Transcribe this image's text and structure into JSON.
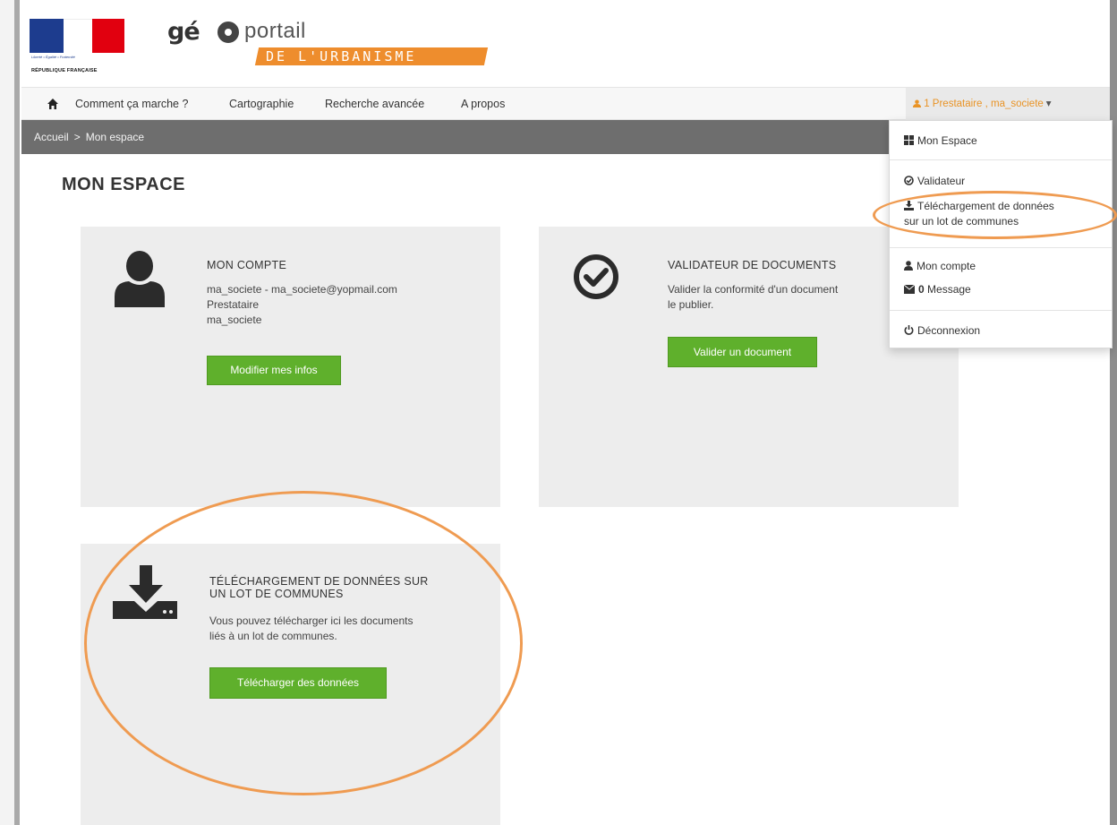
{
  "header": {
    "marianne_motto": "Liberté • Égalité • Fraternité",
    "marianne_country": "RÉPUBLIQUE FRANÇAISE",
    "logo_geo": "gé",
    "logo_portail": "portail",
    "logo_subtitle": "DE L'URBANISME"
  },
  "nav": {
    "items": [
      "Comment ça marche ?",
      "Cartographie",
      "Recherche avancée",
      "A propos"
    ],
    "user_label": "1 Prestataire , ma_societe"
  },
  "breadcrumb": {
    "home": "Accueil",
    "separator": ">",
    "current": "Mon espace"
  },
  "page_title": "MON ESPACE",
  "cards": {
    "account": {
      "title": "MON COMPTE",
      "line1": "ma_societe - ma_societe@yopmail.com",
      "line2": "Prestataire",
      "line3": "ma_societe",
      "button": "Modifier mes infos"
    },
    "validator": {
      "title": "VALIDATEUR DE DOCUMENTS",
      "line1": "Valider la conformité d'un document",
      "line2": "le publier.",
      "button": "Valider un document"
    },
    "download": {
      "title_line1": "TÉLÉCHARGEMENT DE DONNÉES SUR",
      "title_line2": "UN LOT DE COMMUNES",
      "line1": "Vous pouvez télécharger ici les documents",
      "line2": "liés à un lot de communes.",
      "button": "Télécharger des données"
    }
  },
  "dropdown": {
    "mon_espace": "Mon Espace",
    "validateur": "Validateur",
    "telechargement_line1": "Téléchargement de données",
    "telechargement_line2": "sur un lot de communes",
    "mon_compte": "Mon compte",
    "message_count": "0",
    "message_label": "Message",
    "deconnexion": "Déconnexion"
  },
  "colors": {
    "accent_orange": "#ee8d2d",
    "button_green": "#5fb02c",
    "breadcrumb_bg": "#6e6e6e",
    "highlight_ring": "#ef9b51"
  }
}
